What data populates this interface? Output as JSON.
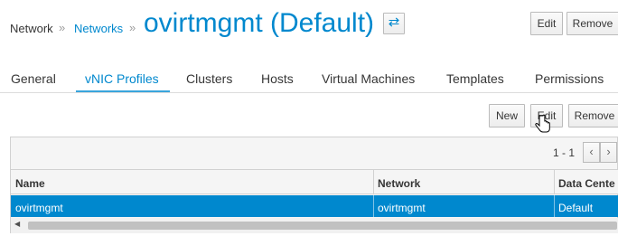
{
  "breadcrumb": {
    "root": "Network",
    "separator": "»",
    "link": "Networks"
  },
  "page": {
    "title": "ovirtmgmt (Default)",
    "swap_icon": "⇄"
  },
  "header_actions": {
    "edit": "Edit",
    "remove": "Remove"
  },
  "tabs": [
    {
      "label": "General"
    },
    {
      "label": "vNIC Profiles",
      "active": true
    },
    {
      "label": "Clusters"
    },
    {
      "label": "Hosts"
    },
    {
      "label": "Virtual Machines"
    },
    {
      "label": "Templates"
    },
    {
      "label": "Permissions"
    }
  ],
  "toolbar": {
    "new": "New",
    "edit": "Edit",
    "remove": "Remove"
  },
  "pager": {
    "range": "1 - 1",
    "prev": "‹",
    "next": "›"
  },
  "grid": {
    "columns": [
      "Name",
      "Network",
      "Data Cente"
    ],
    "rows": [
      {
        "name": "ovirtmgmt",
        "network": "ovirtmgmt",
        "data_center": "Default",
        "selected": true
      }
    ]
  },
  "colors": {
    "accent": "#0088ce",
    "selection": "#0088ce"
  }
}
